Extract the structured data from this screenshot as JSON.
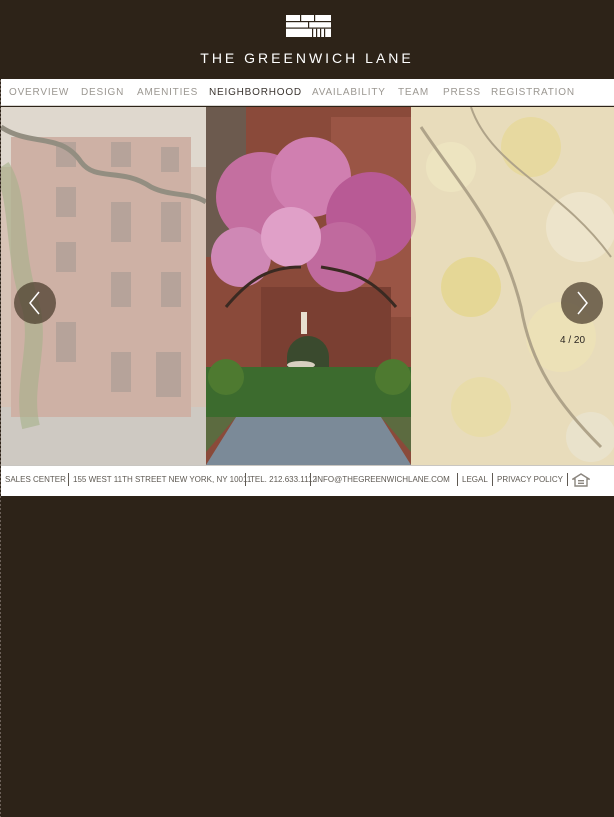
{
  "brand": {
    "name": "THE GREENWICH LANE",
    "logo_icon": "building-logo-icon"
  },
  "nav": {
    "items": [
      {
        "label": "OVERVIEW",
        "active": false
      },
      {
        "label": "DESIGN",
        "active": false
      },
      {
        "label": "AMENITIES",
        "active": false
      },
      {
        "label": "NEIGHBORHOOD",
        "active": true
      },
      {
        "label": "AVAILABILITY",
        "active": false
      },
      {
        "label": "TEAM",
        "active": false
      },
      {
        "label": "PRESS",
        "active": false
      },
      {
        "label": "REGISTRATION",
        "active": false
      }
    ]
  },
  "gallery": {
    "counter": "4 / 20",
    "prev_icon": "chevron-left-icon",
    "next_icon": "chevron-right-icon"
  },
  "footer": {
    "sales_center": "SALES CENTER",
    "address": "155 WEST 11TH STREET NEW YORK, NY 10011",
    "tel": "TEL. 212.633.1112",
    "email": "INFO@THEGREENWICHLANE.COM",
    "legal": "LEGAL",
    "privacy": "PRIVACY POLICY",
    "housing_icon": "equal-housing-icon"
  },
  "colors": {
    "background": "#2d2318",
    "nav_active": "#3b3530",
    "nav_inactive": "#9b9791"
  }
}
